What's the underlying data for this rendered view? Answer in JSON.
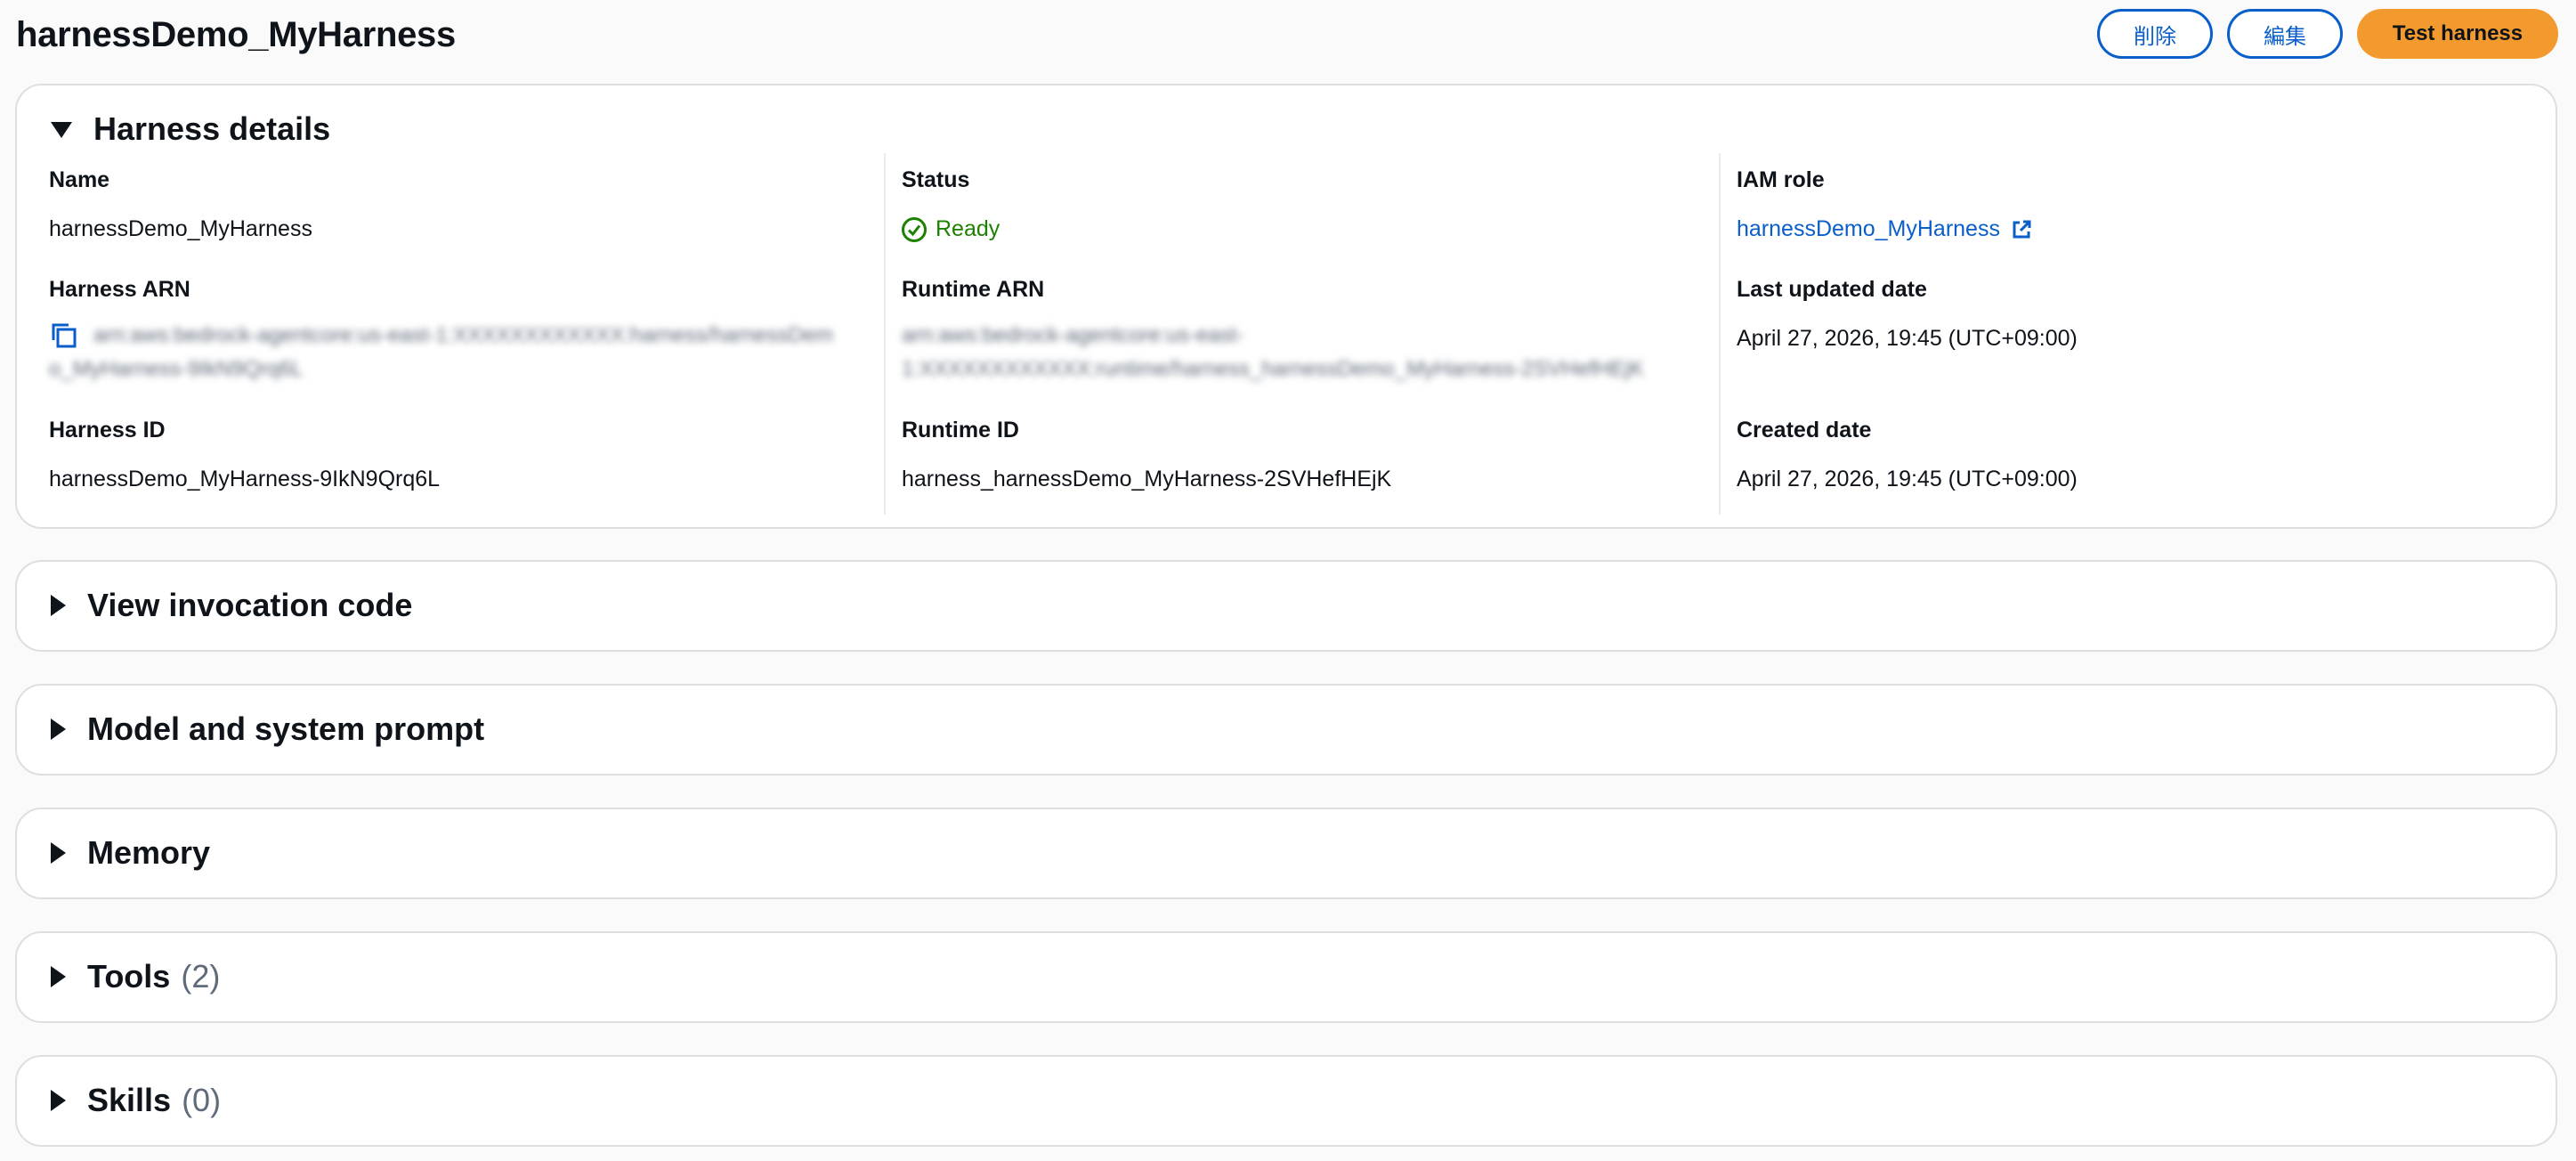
{
  "header": {
    "title": "harnessDemo_MyHarness",
    "delete_label": "削除",
    "edit_label": "編集",
    "test_label": "Test harness"
  },
  "details": {
    "section_title": "Harness details",
    "name_label": "Name",
    "name_value": "harnessDemo_MyHarness",
    "status_label": "Status",
    "status_value": "Ready",
    "iam_label": "IAM role",
    "iam_value": "harnessDemo_MyHarness",
    "harness_arn_label": "Harness ARN",
    "harness_arn_line1": "arn:aws:bedrock-agentcore:us-east-1:XXXXXXXXXXXX:harness/harnessDem",
    "harness_arn_line2": "o_MyHarness-9IkN9Qrq6L",
    "runtime_arn_label": "Runtime ARN",
    "runtime_arn_line1": "arn:aws:bedrock-agentcore:us-east-",
    "runtime_arn_line2": "1:XXXXXXXXXXXX:runtime/harness_harnessDemo_MyHarness-2SVHefHEjK",
    "last_updated_label": "Last updated date",
    "last_updated_value": "April 27, 2026, 19:45 (UTC+09:00)",
    "harness_id_label": "Harness ID",
    "harness_id_value": "harnessDemo_MyHarness-9IkN9Qrq6L",
    "runtime_id_label": "Runtime ID",
    "runtime_id_value": "harness_harnessDemo_MyHarness-2SVHefHEjK",
    "created_label": "Created date",
    "created_value": "April 27, 2026, 19:45 (UTC+09:00)"
  },
  "sections": {
    "invocation": "View invocation code",
    "model": "Model and system prompt",
    "memory": "Memory",
    "tools": "Tools",
    "tools_count": "(2)",
    "skills": "Skills",
    "skills_count": "(0)"
  },
  "colors": {
    "primary_button": "#f29a2e",
    "link": "#0a5ec9",
    "success": "#1d8102"
  }
}
